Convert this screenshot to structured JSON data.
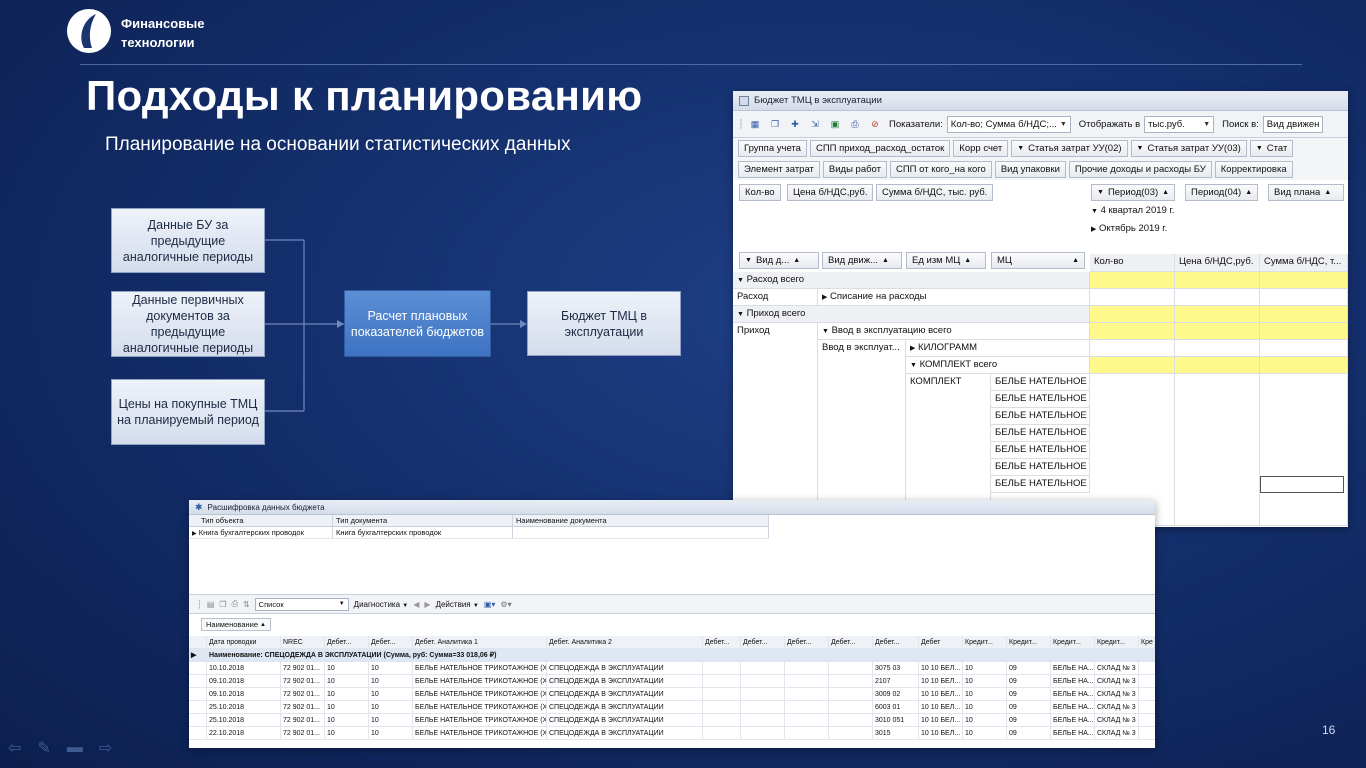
{
  "logo": {
    "line1": "Финансовые",
    "line2": "технологии"
  },
  "slide": {
    "title": "Подходы к планированию",
    "subtitle": "Планирование на основании статистических данных",
    "page_number": "16"
  },
  "diagram": {
    "box1": "Данные БУ за предыдущие аналогичные периоды",
    "box2": "Данные первичных документов за предыдущие аналогичные периоды",
    "box3": "Цены на покупные ТМЦ на планируемый период",
    "box_calc": "Расчет плановых показателей бюджетов",
    "box_result": "Бюджет ТМЦ в эксплуатации"
  },
  "budget_window": {
    "title": "Бюджет ТМЦ в эксплуатации",
    "toolbar": {
      "indicators_label": "Показатели:",
      "indicators_value": "Кол-во; Сумма б/НДС;...",
      "display_label": "Отображать в",
      "display_value": "тыс.руб.",
      "search_label": "Поиск в:",
      "search_value": "Вид движен"
    },
    "filter_row1": [
      "Группа учета",
      "СПП приход_расход_остаток",
      "Корр счет",
      "Статья затрат УУ(02)",
      "Статья затрат УУ(03)",
      "Стат"
    ],
    "filter_row2": [
      "Элемент затрат",
      "Виды работ",
      "СПП от кого_на кого",
      "Вид упаковки",
      "Прочие доходы и расходы БУ",
      "Корректировка"
    ],
    "data_fields": [
      "Кол-во",
      "Цена б/НДС,руб.",
      "Сумма б/НДС, тыс. руб."
    ],
    "column_fields": [
      "Период(03)",
      "Период(04)",
      "Вид плана"
    ],
    "column_values": {
      "quarter": "4 квартал 2019 г.",
      "month": "Октябрь 2019 г."
    },
    "row_fields": [
      "Вид д...",
      "Вид движ...",
      "Ед изм МЦ",
      "МЦ"
    ],
    "measure_headers": [
      "Кол-во",
      "Цена б/НДС,руб.",
      "Сумма б/НДС, т..."
    ],
    "rows": {
      "expense_total": "Расход всего",
      "expense": "Расход",
      "write_off": "Списание на расходы",
      "income_total": "Приход всего",
      "income": "Приход",
      "commissioning_total": "Ввод в эксплуатацию всего",
      "commissioning": "Ввод в эксплуат...",
      "kilogram": "КИЛОГРАММ",
      "set_total": "КОМПЛЕКТ всего",
      "set": "КОМПЛЕКТ",
      "item": "БЕЛЬЕ НАТЕЛЬНОЕ ..."
    }
  },
  "decode_window": {
    "title": "Расшифровка данных бюджета",
    "grid_headers": [
      "Тип объекта",
      "Тип документа",
      "Наименование документа"
    ],
    "grid_row": [
      "Книга бухгалтерских проводок",
      "Книга бухгалтерских проводок",
      ""
    ],
    "toolbar": {
      "view": "Список",
      "diagnostics": "Диагностика",
      "actions": "Действия"
    },
    "group_field": "Наименование",
    "table_headers": [
      "Дата проводки",
      "NREC",
      "Дебет...",
      "Дебет...",
      "Дебет. Аналитика 1",
      "Дебет. Аналитика 2",
      "Дебет...",
      "Дебет...",
      "Дебет...",
      "Дебет...",
      "Дебет...",
      "Дебет",
      "Кредит...",
      "Кредит...",
      "Кредит...",
      "Кредит...",
      "Кре"
    ],
    "group_row": "Наименование: СПЕЦОДЕЖДА В ЭКСПЛУАТАЦИИ (Сумма, руб: Сумма=33 018,06 ₽)",
    "rows": [
      [
        "10.10.2018",
        "72 902 01...",
        "10",
        "10",
        "БЕЛЬЕ НАТЕЛЬНОЕ ТРИКОТАЖНОЕ (Х/...",
        "СПЕЦОДЕЖДА В ЭКСПЛУАТАЦИИ",
        "3075 03",
        "10 10 БЕЛ...",
        "10",
        "09",
        "БЕЛЬЕ НА...",
        "СКЛАД № 3"
      ],
      [
        "09.10.2018",
        "72 902 01...",
        "10",
        "10",
        "БЕЛЬЕ НАТЕЛЬНОЕ ТРИКОТАЖНОЕ (Х/...",
        "СПЕЦОДЕЖДА В ЭКСПЛУАТАЦИИ",
        "2107",
        "10 10 БЕЛ...",
        "10",
        "09",
        "БЕЛЬЕ НА...",
        "СКЛАД № 3"
      ],
      [
        "09.10.2018",
        "72 902 01...",
        "10",
        "10",
        "БЕЛЬЕ НАТЕЛЬНОЕ ТРИКОТАЖНОЕ (Х/...",
        "СПЕЦОДЕЖДА В ЭКСПЛУАТАЦИИ",
        "3009 02",
        "10 10 БЕЛ...",
        "10",
        "09",
        "БЕЛЬЕ НА...",
        "СКЛАД № 3"
      ],
      [
        "25.10.2018",
        "72 902 01...",
        "10",
        "10",
        "БЕЛЬЕ НАТЕЛЬНОЕ ТРИКОТАЖНОЕ (Х/...",
        "СПЕЦОДЕЖДА В ЭКСПЛУАТАЦИИ",
        "6003 01",
        "10 10 БЕЛ...",
        "10",
        "09",
        "БЕЛЬЕ НА...",
        "СКЛАД № 3"
      ],
      [
        "25.10.2018",
        "72 902 01...",
        "10",
        "10",
        "БЕЛЬЕ НАТЕЛЬНОЕ ТРИКОТАЖНОЕ (Х/...",
        "СПЕЦОДЕЖДА В ЭКСПЛУАТАЦИИ",
        "3010 051",
        "10 10 БЕЛ...",
        "10",
        "09",
        "БЕЛЬЕ НА...",
        "СКЛАД № 3"
      ],
      [
        "22.10.2018",
        "72 902 01...",
        "10",
        "10",
        "БЕЛЬЕ НАТЕЛЬНОЕ ТРИКОТАЖНОЕ (Х/...",
        "СПЕЦОДЕЖДА В ЭКСПЛУАТАЦИИ",
        "3015",
        "10 10 БЕЛ...",
        "10",
        "09",
        "БЕЛЬЕ НА...",
        "СКЛАД № 3"
      ]
    ]
  }
}
